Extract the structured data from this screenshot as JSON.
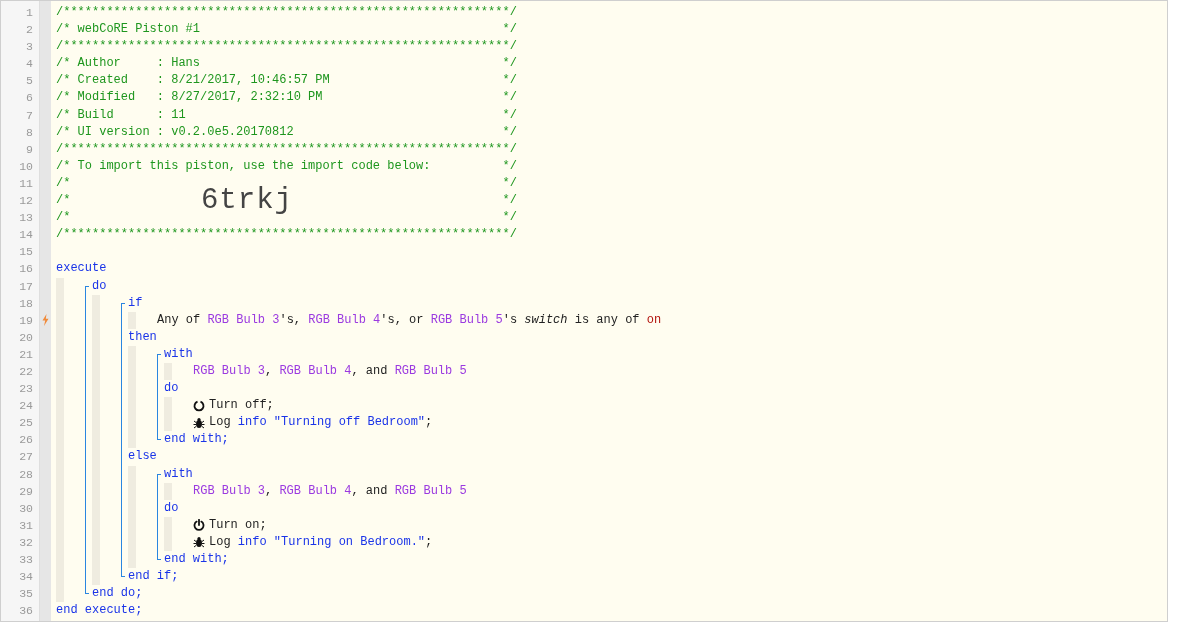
{
  "header": [
    {
      "number": "1",
      "tokens": [
        {
          "kind": "comment",
          "text": "/**************************************************************/"
        }
      ]
    },
    {
      "number": "2",
      "tokens": [
        {
          "kind": "comment",
          "text": "/* webCoRE Piston #1"
        },
        {
          "kind": "comment-end",
          "text": "*/"
        }
      ]
    },
    {
      "number": "3",
      "tokens": [
        {
          "kind": "comment",
          "text": "/**************************************************************/"
        }
      ]
    },
    {
      "number": "4",
      "tokens": [
        {
          "kind": "comment",
          "text": "/* Author     : Hans"
        },
        {
          "kind": "comment-end",
          "text": "*/"
        }
      ]
    },
    {
      "number": "5",
      "tokens": [
        {
          "kind": "comment",
          "text": "/* Created    : 8/21/2017, 10:46:57 PM"
        },
        {
          "kind": "comment-end",
          "text": "*/"
        }
      ]
    },
    {
      "number": "6",
      "tokens": [
        {
          "kind": "comment",
          "text": "/* Modified   : 8/27/2017, 2:32:10 PM"
        },
        {
          "kind": "comment-end",
          "text": "*/"
        }
      ]
    },
    {
      "number": "7",
      "tokens": [
        {
          "kind": "comment",
          "text": "/* Build      : 11"
        },
        {
          "kind": "comment-end",
          "text": "*/"
        }
      ]
    },
    {
      "number": "8",
      "tokens": [
        {
          "kind": "comment",
          "text": "/* UI version : v0.2.0e5.20170812"
        },
        {
          "kind": "comment-end",
          "text": "*/"
        }
      ]
    },
    {
      "number": "9",
      "tokens": [
        {
          "kind": "comment",
          "text": "/**************************************************************/"
        }
      ]
    },
    {
      "number": "10",
      "tokens": [
        {
          "kind": "comment",
          "text": "/* To import this piston, use the import code below:"
        },
        {
          "kind": "comment-end",
          "text": "*/"
        }
      ]
    },
    {
      "number": "11",
      "tokens": [
        {
          "kind": "comment",
          "text": "/*"
        },
        {
          "kind": "comment-end",
          "text": "*/"
        }
      ]
    },
    {
      "number": "12",
      "tokens": [
        {
          "kind": "comment",
          "text": "/*"
        },
        {
          "kind": "import-code",
          "text": "6trkj"
        },
        {
          "kind": "comment-end",
          "text": "*/"
        }
      ]
    },
    {
      "number": "13",
      "tokens": [
        {
          "kind": "comment",
          "text": "/*"
        },
        {
          "kind": "comment-end",
          "text": "*/"
        }
      ]
    },
    {
      "number": "14",
      "tokens": [
        {
          "kind": "comment",
          "text": "/**************************************************************/"
        }
      ]
    },
    {
      "number": "15"
    }
  ],
  "code": {
    "kind": "block",
    "bracket": false,
    "sections": [
      {
        "line": "16",
        "tokens": [
          {
            "kind": "keyword",
            "text": "execute"
          }
        ],
        "body": [
          {
            "kind": "block",
            "bracket": true,
            "sections": [
              {
                "line": "17",
                "tokens": [
                  {
                    "kind": "keyword",
                    "text": "do"
                  }
                ],
                "body": [
                  {
                    "kind": "block",
                    "bracket": true,
                    "sections": [
                      {
                        "line": "18",
                        "tokens": [
                          {
                            "kind": "keyword",
                            "text": "if"
                          }
                        ],
                        "body": [
                          {
                            "kind": "trigger",
                            "line": "19",
                            "tokens": [
                              {
                                "kind": "text",
                                "text": "Any of "
                              },
                              {
                                "kind": "device",
                                "text": "RGB Bulb 3"
                              },
                              {
                                "kind": "text",
                                "text": "'s, "
                              },
                              {
                                "kind": "device",
                                "text": "RGB Bulb 4"
                              },
                              {
                                "kind": "text",
                                "text": "'s, or "
                              },
                              {
                                "kind": "device",
                                "text": "RGB Bulb 5"
                              },
                              {
                                "kind": "text",
                                "text": "'s "
                              },
                              {
                                "kind": "italic",
                                "text": "switch"
                              },
                              {
                                "kind": "text",
                                "text": " is any of "
                              },
                              {
                                "kind": "value",
                                "text": "on"
                              }
                            ]
                          }
                        ]
                      },
                      {
                        "line": "20",
                        "tokens": [
                          {
                            "kind": "keyword",
                            "text": "then"
                          }
                        ],
                        "body": [
                          {
                            "kind": "block",
                            "bracket": true,
                            "sections": [
                              {
                                "line": "21",
                                "tokens": [
                                  {
                                    "kind": "keyword",
                                    "text": "with"
                                  }
                                ],
                                "body": [
                                  {
                                    "kind": "statement",
                                    "line": "22",
                                    "tokens": [
                                      {
                                        "kind": "device",
                                        "text": "RGB Bulb 3"
                                      },
                                      {
                                        "kind": "text",
                                        "text": ", "
                                      },
                                      {
                                        "kind": "device",
                                        "text": "RGB Bulb 4"
                                      },
                                      {
                                        "kind": "text",
                                        "text": ", and "
                                      },
                                      {
                                        "kind": "device",
                                        "text": "RGB Bulb 5"
                                      }
                                    ]
                                  }
                                ]
                              },
                              {
                                "line": "23",
                                "tokens": [
                                  {
                                    "kind": "keyword",
                                    "text": "do"
                                  }
                                ],
                                "body": [
                                  {
                                    "kind": "switch-off",
                                    "line": "24",
                                    "tokens": [
                                      {
                                        "kind": "text",
                                        "text": "Turn off;"
                                      }
                                    ]
                                  },
                                  {
                                    "kind": "log",
                                    "line": "25",
                                    "tokens": [
                                      {
                                        "kind": "text",
                                        "text": "Log "
                                      },
                                      {
                                        "kind": "keyword",
                                        "text": "info"
                                      },
                                      {
                                        "kind": "string",
                                        "text": " \"Turning off Bedroom\""
                                      },
                                      {
                                        "kind": "text",
                                        "text": ";"
                                      }
                                    ]
                                  }
                                ]
                              }
                            ],
                            "end": {
                              "line": "26",
                              "tokens": [
                                {
                                  "kind": "keyword",
                                  "text": "end with;"
                                }
                              ]
                            }
                          }
                        ]
                      },
                      {
                        "line": "27",
                        "tokens": [
                          {
                            "kind": "keyword",
                            "text": "else"
                          }
                        ],
                        "body": [
                          {
                            "kind": "block",
                            "bracket": true,
                            "sections": [
                              {
                                "line": "28",
                                "tokens": [
                                  {
                                    "kind": "keyword",
                                    "text": "with"
                                  }
                                ],
                                "body": [
                                  {
                                    "kind": "statement",
                                    "line": "29",
                                    "tokens": [
                                      {
                                        "kind": "device",
                                        "text": "RGB Bulb 3"
                                      },
                                      {
                                        "kind": "text",
                                        "text": ", "
                                      },
                                      {
                                        "kind": "device",
                                        "text": "RGB Bulb 4"
                                      },
                                      {
                                        "kind": "text",
                                        "text": ", and "
                                      },
                                      {
                                        "kind": "device",
                                        "text": "RGB Bulb 5"
                                      }
                                    ]
                                  }
                                ]
                              },
                              {
                                "line": "30",
                                "tokens": [
                                  {
                                    "kind": "keyword",
                                    "text": "do"
                                  }
                                ],
                                "body": [
                                  {
                                    "kind": "switch-on",
                                    "line": "31",
                                    "tokens": [
                                      {
                                        "kind": "text",
                                        "text": "Turn on;"
                                      }
                                    ]
                                  },
                                  {
                                    "kind": "log",
                                    "line": "32",
                                    "tokens": [
                                      {
                                        "kind": "text",
                                        "text": "Log "
                                      },
                                      {
                                        "kind": "keyword",
                                        "text": "info"
                                      },
                                      {
                                        "kind": "string",
                                        "text": " \"Turning on Bedroom.\""
                                      },
                                      {
                                        "kind": "text",
                                        "text": ";"
                                      }
                                    ]
                                  }
                                ]
                              }
                            ],
                            "end": {
                              "line": "33",
                              "tokens": [
                                {
                                  "kind": "keyword",
                                  "text": "end with;"
                                }
                              ]
                            }
                          }
                        ]
                      }
                    ],
                    "end": {
                      "line": "34",
                      "tokens": [
                        {
                          "kind": "keyword",
                          "text": "end if;"
                        }
                      ]
                    }
                  }
                ]
              }
            ],
            "end": {
              "line": "35",
              "tokens": [
                {
                  "kind": "keyword",
                  "text": "end do;"
                }
              ]
            }
          }
        ]
      }
    ],
    "end": {
      "line": "36",
      "tokens": [
        {
          "kind": "keyword",
          "text": "end execute;"
        }
      ]
    }
  }
}
